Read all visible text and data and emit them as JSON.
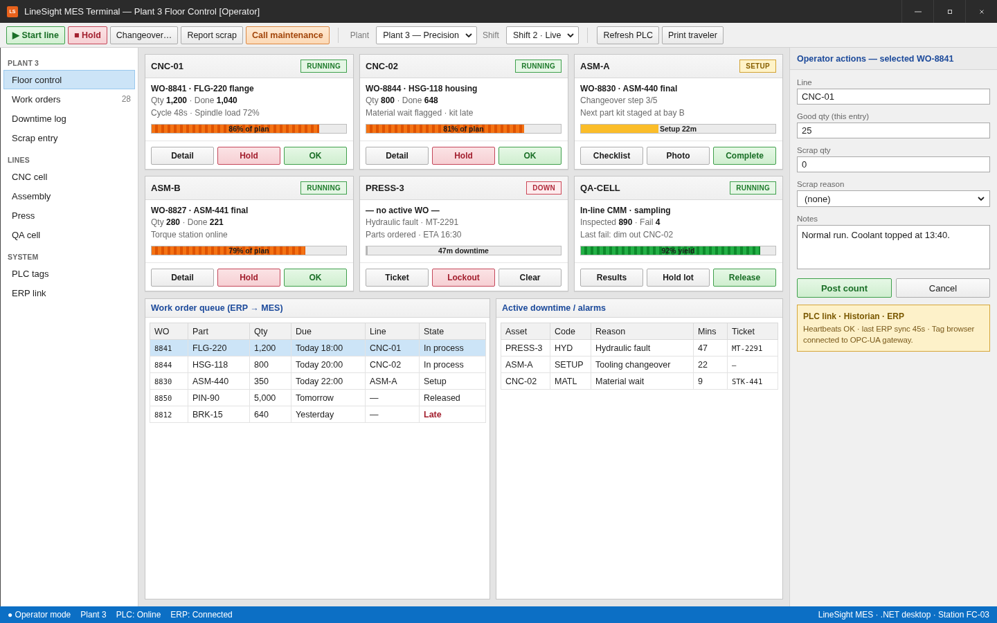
{
  "window": {
    "logo": "LS",
    "title": "LineSight MES Terminal — Plant 3 Floor Control [Operator]"
  },
  "toolbar": {
    "actions": [
      {
        "label": "▶ Start line",
        "kind": "start"
      },
      {
        "label": "■ Hold",
        "kind": "hold"
      },
      {
        "label": "Changeover…",
        "kind": "plain"
      },
      {
        "label": "Report scrap",
        "kind": "plain"
      },
      {
        "label": "Call maintenance",
        "kind": "alert"
      }
    ],
    "selectors": [
      {
        "label": "Plant",
        "value": "Plant 3 — Precision"
      },
      {
        "label": "Shift",
        "value": "Shift 2 · Live"
      }
    ],
    "tools": [
      "Refresh PLC",
      "Print traveler"
    ]
  },
  "sidebar": {
    "sections": [
      {
        "heading": "PLANT 3",
        "items": [
          {
            "label": "Floor control",
            "selected": true
          },
          {
            "label": "Work orders",
            "count": "28",
            "selected": false
          },
          {
            "label": "Downtime log",
            "selected": false
          },
          {
            "label": "Scrap entry",
            "selected": false
          }
        ]
      },
      {
        "heading": "LINES",
        "items": [
          {
            "label": "CNC cell",
            "selected": false
          },
          {
            "label": "Assembly",
            "selected": false
          },
          {
            "label": "Press",
            "selected": false
          },
          {
            "label": "QA cell",
            "selected": false
          }
        ]
      },
      {
        "heading": "SYSTEM",
        "items": [
          {
            "label": "PLC tags",
            "selected": false
          },
          {
            "label": "ERP link",
            "selected": false
          }
        ]
      }
    ]
  },
  "machines": [
    {
      "name": "CNC-01",
      "status": {
        "label": "RUNNING",
        "kind": "running"
      },
      "title": "WO-8841 · FLG-220 flange",
      "lines": [
        "Qty **1,200** · Done **1,040**",
        "Cycle 48s · Spindle load 72%"
      ],
      "bar": {
        "kind": "output",
        "level": 0.86,
        "label": "86% of plan"
      },
      "buttons": [
        {
          "label": "Detail",
          "kind": "plain"
        },
        {
          "label": "Hold",
          "kind": "hold"
        },
        {
          "label": "OK",
          "kind": "ok"
        }
      ]
    },
    {
      "name": "CNC-02",
      "status": {
        "label": "RUNNING",
        "kind": "running"
      },
      "title": "WO-8844 · HSG-118 housing",
      "lines": [
        "Qty **800** · Done **648**",
        "Material wait flagged · kit late"
      ],
      "bar": {
        "kind": "output",
        "level": 0.81,
        "label": "81% of plan"
      },
      "buttons": [
        {
          "label": "Detail",
          "kind": "plain"
        },
        {
          "label": "Hold",
          "kind": "hold"
        },
        {
          "label": "OK",
          "kind": "ok"
        }
      ]
    },
    {
      "name": "ASM-A",
      "status": {
        "label": "SETUP",
        "kind": "setup"
      },
      "title": "WO-8830 · ASM-440 final",
      "lines": [
        "Changeover step 3/5",
        "Next part kit staged at bay B"
      ],
      "bar": {
        "kind": "setup",
        "level": 0.4,
        "label": "Setup 22m"
      },
      "buttons": [
        {
          "label": "Checklist",
          "kind": "plain"
        },
        {
          "label": "Photo",
          "kind": "plain"
        },
        {
          "label": "Complete",
          "kind": "ok"
        }
      ]
    },
    {
      "name": "ASM-B",
      "status": {
        "label": "RUNNING",
        "kind": "running"
      },
      "title": "WO-8827 · ASM-441 final",
      "lines": [
        "Qty **280** · Done **221**",
        "Torque station online"
      ],
      "bar": {
        "kind": "output",
        "level": 0.79,
        "label": "79% of plan"
      },
      "buttons": [
        {
          "label": "Detail",
          "kind": "plain"
        },
        {
          "label": "Hold",
          "kind": "hold"
        },
        {
          "label": "OK",
          "kind": "ok"
        }
      ]
    },
    {
      "name": "PRESS-3",
      "status": {
        "label": "DOWN",
        "kind": "down"
      },
      "title": "— no active WO —",
      "lines": [
        "Hydraulic fault · MT-2291",
        "Parts ordered · ETA 16:30"
      ],
      "bar": {
        "kind": "downtime",
        "level": 0,
        "label": "47m downtime"
      },
      "buttons": [
        {
          "label": "Ticket",
          "kind": "plain"
        },
        {
          "label": "Lockout",
          "kind": "hold"
        },
        {
          "label": "Clear",
          "kind": "plain"
        }
      ]
    },
    {
      "name": "QA-CELL",
      "status": {
        "label": "RUNNING",
        "kind": "running"
      },
      "title": "In-line CMM · sampling",
      "lines": [
        "Inspected **890** · Fail **4**",
        "Last fail: dim out CNC-02"
      ],
      "bar": {
        "kind": "yield",
        "level": 0.92,
        "label": "92% yield"
      },
      "buttons": [
        {
          "label": "Results",
          "kind": "plain"
        },
        {
          "label": "Hold lot",
          "kind": "plain"
        },
        {
          "label": "Release",
          "kind": "ok"
        }
      ]
    }
  ],
  "work_order_queue": {
    "title": "Work order queue (ERP → MES)",
    "columns": [
      {
        "label": "WO",
        "kind": "mono"
      },
      {
        "label": "Part",
        "kind": "text"
      },
      {
        "label": "Qty",
        "kind": "text"
      },
      {
        "label": "Due",
        "kind": "text"
      },
      {
        "label": "Line",
        "kind": "text"
      },
      {
        "label": "State",
        "kind": "text"
      }
    ],
    "rows": [
      {
        "cells": [
          "8841",
          "FLG-220",
          "1,200",
          "Today 18:00",
          "CNC-01",
          "In process"
        ],
        "selected": true,
        "late": false
      },
      {
        "cells": [
          "8844",
          "HSG-118",
          "800",
          "Today 20:00",
          "CNC-02",
          "In process"
        ],
        "selected": false,
        "late": false
      },
      {
        "cells": [
          "8830",
          "ASM-440",
          "350",
          "Today 22:00",
          "ASM-A",
          "Setup"
        ],
        "selected": false,
        "late": false
      },
      {
        "cells": [
          "8850",
          "PIN-90",
          "5,000",
          "Tomorrow",
          "—",
          "Released"
        ],
        "selected": false,
        "late": false
      },
      {
        "cells": [
          "8812",
          "BRK-15",
          "640",
          "Yesterday",
          "—",
          "Late"
        ],
        "selected": false,
        "late": true
      }
    ]
  },
  "downtime": {
    "title": "Active downtime / alarms",
    "columns": [
      {
        "label": "Asset",
        "kind": "text"
      },
      {
        "label": "Code",
        "kind": "text"
      },
      {
        "label": "Reason",
        "kind": "text"
      },
      {
        "label": "Mins",
        "kind": "text"
      },
      {
        "label": "Ticket",
        "kind": "mono"
      }
    ],
    "rows": [
      [
        "PRESS-3",
        "HYD",
        "Hydraulic fault",
        "47",
        "MT-2291"
      ],
      [
        "ASM-A",
        "SETUP",
        "Tooling changeover",
        "22",
        "–"
      ],
      [
        "CNC-02",
        "MATL",
        "Material wait",
        "9",
        "STK-441"
      ]
    ]
  },
  "operator_actions": {
    "title": "Operator actions — selected WO-8841",
    "fields": [
      {
        "label": "Line",
        "kind": "input",
        "value": "CNC-01"
      },
      {
        "label": "Good qty (this entry)",
        "kind": "input",
        "value": "25"
      },
      {
        "label": "Scrap qty",
        "kind": "input",
        "value": "0"
      },
      {
        "label": "Scrap reason",
        "kind": "select",
        "value": "(none)"
      },
      {
        "label": "Notes",
        "kind": "textarea",
        "value": "Normal run. Coolant topped at 13:40."
      }
    ],
    "buttons": [
      {
        "label": "Post count",
        "kind": "ok"
      },
      {
        "label": "Cancel",
        "kind": "plain"
      }
    ],
    "notice": {
      "title": "PLC link · Historian · ERP",
      "text": "Heartbeats OK · last ERP sync 45s · Tag browser connected to OPC-UA gateway."
    }
  },
  "status_bar": {
    "left": [
      "● Operator mode",
      "Plant 3",
      "PLC: Online",
      "ERP: Connected"
    ],
    "right": "LineSight MES · .NET desktop · Station FC-03"
  }
}
